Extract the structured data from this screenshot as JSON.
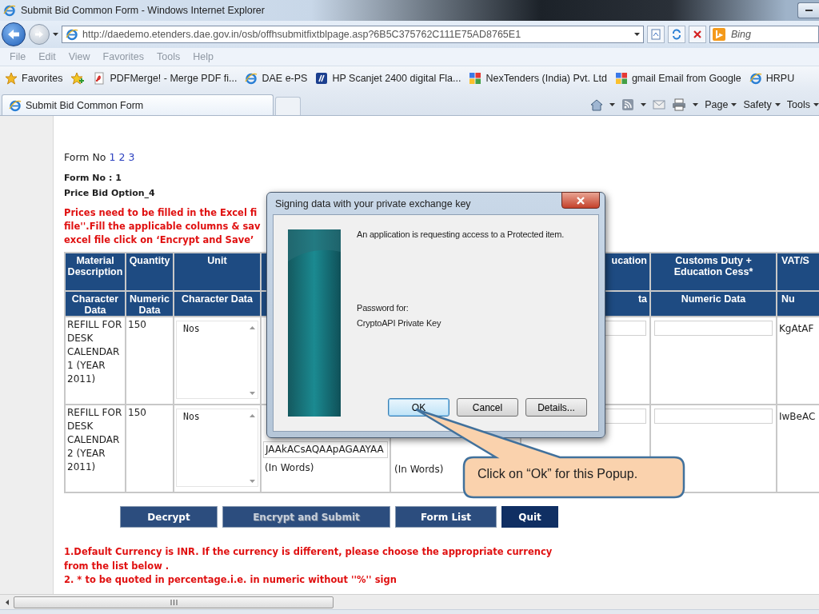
{
  "window": {
    "title": "Submit Bid Common Form - Windows Internet Explorer"
  },
  "address_bar": {
    "url": "http://daedemo.etenders.dae.gov.in/osb/offhsubmitfixtblpage.asp?6B5C375762C111E75AD8765E1",
    "search_placeholder": "Bing"
  },
  "menu": [
    "File",
    "Edit",
    "View",
    "Favorites",
    "Tools",
    "Help"
  ],
  "favorites_bar": {
    "label": "Favorites",
    "items": [
      {
        "label": "PDFMerge! - Merge PDF fi...",
        "kind": "pdf"
      },
      {
        "label": "DAE e-PS",
        "kind": "web"
      },
      {
        "label": "HP Scanjet 2400 digital Fla...",
        "kind": "scanner"
      },
      {
        "label": "NexTenders (India) Pvt. Ltd",
        "kind": "tiles"
      },
      {
        "label": "gmail Email from Google",
        "kind": "tiles"
      },
      {
        "label": "HRPU",
        "kind": "web"
      }
    ]
  },
  "tabs": [
    {
      "label": "Submit Bid Common Form",
      "selected": true
    }
  ],
  "command_bar": [
    "Page",
    "Safety",
    "Tools"
  ],
  "page": {
    "form_links_label": "Form No",
    "form_links": [
      "1",
      "2",
      "3"
    ],
    "form_no": "Form No : 1",
    "option": "Price Bid Option_4",
    "instruction_lines": [
      "Prices need to be filled in the Excel fi",
      "file''.Fill the applicable columns & sav",
      "excel file click on ‘Encrypt and Save’"
    ],
    "table": {
      "columns": [
        {
          "title": "Material Description",
          "type": "Character Data"
        },
        {
          "title": "Quantity",
          "type": "Numeric Data"
        },
        {
          "title": "Unit",
          "type": "Character Data"
        },
        {},
        {},
        {
          "title": "ucation",
          "type": "ta"
        },
        {
          "title": "Customs Duty + Education Cess*",
          "type": "Numeric Data"
        },
        {
          "title": "VAT/S",
          "type": "Nu"
        }
      ],
      "rows": [
        {
          "material": "REFILL FOR DESK CALENDAR 1 (YEAR 2011)",
          "quantity": "150",
          "unit": "Nos",
          "vat": "KgAtAF"
        },
        {
          "material": "REFILL FOR DESK CALENDAR 2 (YEAR 2011)",
          "quantity": "150",
          "unit": "Nos",
          "amount_value": "JAAkACsAQAApAGAAYAA",
          "amount_words": "(In Words)",
          "rate_words": "(In Words)",
          "vat": "IwBeAC"
        }
      ]
    },
    "buttons": [
      {
        "label": "Decrypt",
        "disabled": false,
        "focused": false
      },
      {
        "label": "Encrypt and Submit",
        "disabled": true,
        "focused": false
      },
      {
        "label": "Form List",
        "disabled": false,
        "focused": false
      },
      {
        "label": "Quit",
        "disabled": false,
        "focused": true
      }
    ],
    "notes": [
      "1.Default Currency is INR. If the currency is different, please choose the appropriate currency from the list below .",
      "2. * to be quoted in percentage.i.e. in numeric without ''%'' sign"
    ]
  },
  "dialog": {
    "title": "Signing data with your private exchange key",
    "message": "An application is requesting access to a Protected item.",
    "password_label": "Password for:",
    "key_name": "CryptoAPI Private Key",
    "buttons": [
      {
        "label": "OK",
        "focused": true
      },
      {
        "label": "Cancel",
        "focused": false
      },
      {
        "label": "Details...",
        "focused": false
      }
    ]
  },
  "annotation": {
    "text": "Click on “Ok” for this Popup."
  }
}
